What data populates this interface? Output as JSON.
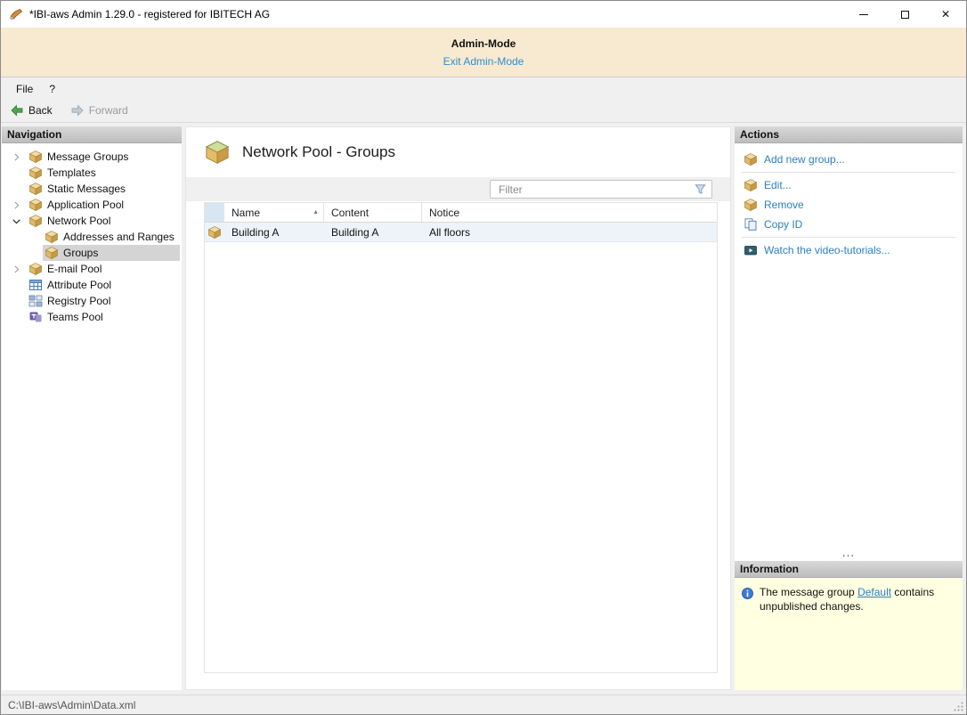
{
  "window": {
    "title": "*IBI-aws Admin 1.29.0 - registered for IBITECH AG",
    "close_glyph": "✕"
  },
  "admin_banner": {
    "title": "Admin-Mode",
    "exit_link": "Exit Admin-Mode"
  },
  "menu": {
    "file": "File",
    "help": "?"
  },
  "toolbar": {
    "back": "Back",
    "forward": "Forward"
  },
  "navigation": {
    "header": "Navigation",
    "items": [
      {
        "label": "Message Groups",
        "icon": "box-icon",
        "expandable": true
      },
      {
        "label": "Templates",
        "icon": "box-icon"
      },
      {
        "label": "Static Messages",
        "icon": "box-icon"
      },
      {
        "label": "Application Pool",
        "icon": "box-icon",
        "expandable": true
      },
      {
        "label": "Network Pool",
        "icon": "box-icon",
        "expanded": true
      },
      {
        "label": "Addresses and Ranges",
        "icon": "box-icon",
        "child": true
      },
      {
        "label": "Groups",
        "icon": "box-icon",
        "child": true,
        "selected": true
      },
      {
        "label": "E-mail Pool",
        "icon": "box-icon",
        "expandable": true
      },
      {
        "label": "Attribute Pool",
        "icon": "table-icon"
      },
      {
        "label": "Registry Pool",
        "icon": "registry-icon"
      },
      {
        "label": "Teams Pool",
        "icon": "teams-icon"
      }
    ]
  },
  "main": {
    "title": "Network Pool - Groups",
    "title_icon": "group-box-icon",
    "filter_placeholder": "Filter",
    "sort_asc_glyph": "▲",
    "table": {
      "columns": [
        "Name",
        "Content",
        "Notice"
      ],
      "rows": [
        {
          "icon": "box-icon",
          "name": "Building A",
          "content": "Building A",
          "notice": "All floors"
        }
      ]
    }
  },
  "actions": {
    "header": "Actions",
    "items": [
      {
        "label": "Add new group...",
        "icon": "group-add-icon"
      },
      {
        "label": "Edit...",
        "icon": "group-edit-icon"
      },
      {
        "label": "Remove",
        "icon": "group-remove-icon"
      },
      {
        "label": "Copy ID",
        "icon": "copy-icon"
      },
      {
        "label": "Watch the video-tutorials...",
        "icon": "video-icon"
      }
    ]
  },
  "splitter_glyph": "…",
  "information": {
    "header": "Information",
    "icon": "info-icon",
    "text_before": "The message group ",
    "link_label": "Default",
    "text_after": " contains unpublished changes."
  },
  "status_bar": {
    "path": "C:\\IBI-aws\\Admin\\Data.xml"
  },
  "colors": {
    "banner_bg": "#f7ead1",
    "link_blue": "#2d7fc1",
    "info_bg": "#ffffe1",
    "selection_gray": "#d4d4d4"
  }
}
